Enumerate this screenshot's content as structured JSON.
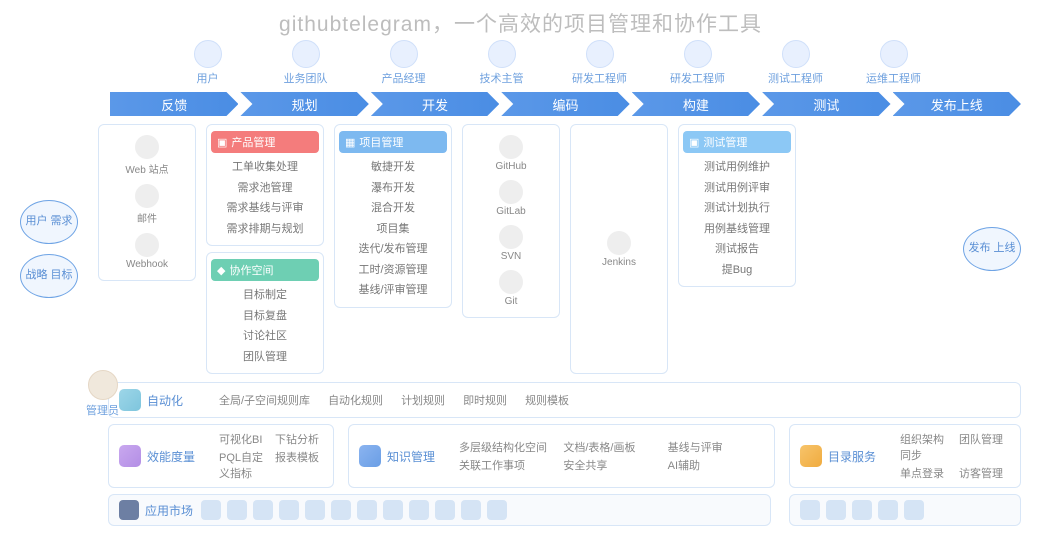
{
  "title": "githubtelegram，一个高效的项目管理和协作工具",
  "roles": [
    "用户",
    "业务团队",
    "产品经理",
    "技术主管",
    "研发工程师",
    "研发工程师",
    "测试工程师",
    "运维工程师"
  ],
  "stages": [
    "反馈",
    "规划",
    "开发",
    "编码",
    "构建",
    "测试",
    "发布上线"
  ],
  "left": [
    "用户\n需求",
    "战略\n目标"
  ],
  "right_goal": "发布\n上线",
  "admin": "管理员",
  "channels": {
    "label": "",
    "items": [
      {
        "n": "Web 站点"
      },
      {
        "n": "邮件"
      },
      {
        "n": "Webhook"
      }
    ]
  },
  "prodmgr": {
    "h": "产品管理",
    "items": [
      "工单收集处理",
      "需求池管理",
      "需求基线与评审",
      "需求排期与规划"
    ]
  },
  "collab": {
    "h": "协作空间",
    "items": [
      "目标制定",
      "目标复盘",
      "讨论社区",
      "团队管理"
    ]
  },
  "projmgr": {
    "h": "项目管理",
    "items": [
      "敏捷开发",
      "瀑布开发",
      "混合开发",
      "项目集",
      "迭代/发布管理",
      "工时/资源管理",
      "基线/评审管理"
    ]
  },
  "code": {
    "items": [
      {
        "n": "GitHub"
      },
      {
        "n": "GitLab"
      },
      {
        "n": "SVN"
      },
      {
        "n": "Git"
      }
    ]
  },
  "build": {
    "items": [
      {
        "n": "Jenkins"
      }
    ]
  },
  "testmgr": {
    "h": "测试管理",
    "items": [
      "测试用例维护",
      "测试用例评审",
      "测试计划执行",
      "用例基线管理",
      "测试报告",
      "提Bug"
    ]
  },
  "auto": {
    "h": "自动化",
    "items": [
      "全局/子空间规则库",
      "自动化规则",
      "计划规则",
      "即时规则",
      "规则模板"
    ]
  },
  "perf": {
    "h": "效能度量",
    "items": [
      "可视化BI",
      "下钻分析",
      "PQL自定义指标",
      "报表模板"
    ]
  },
  "know": {
    "h": "知识管理",
    "items": [
      "多层级结构化空间",
      "文档/表格/画板",
      "基线与评审",
      "关联工作事项",
      "安全共享",
      "AI辅助"
    ]
  },
  "dir": {
    "h": "目录服务",
    "items": [
      "组织架构同步",
      "团队管理",
      "单点登录",
      "访客管理"
    ]
  },
  "store": {
    "h": "应用市场",
    "count": 12
  }
}
